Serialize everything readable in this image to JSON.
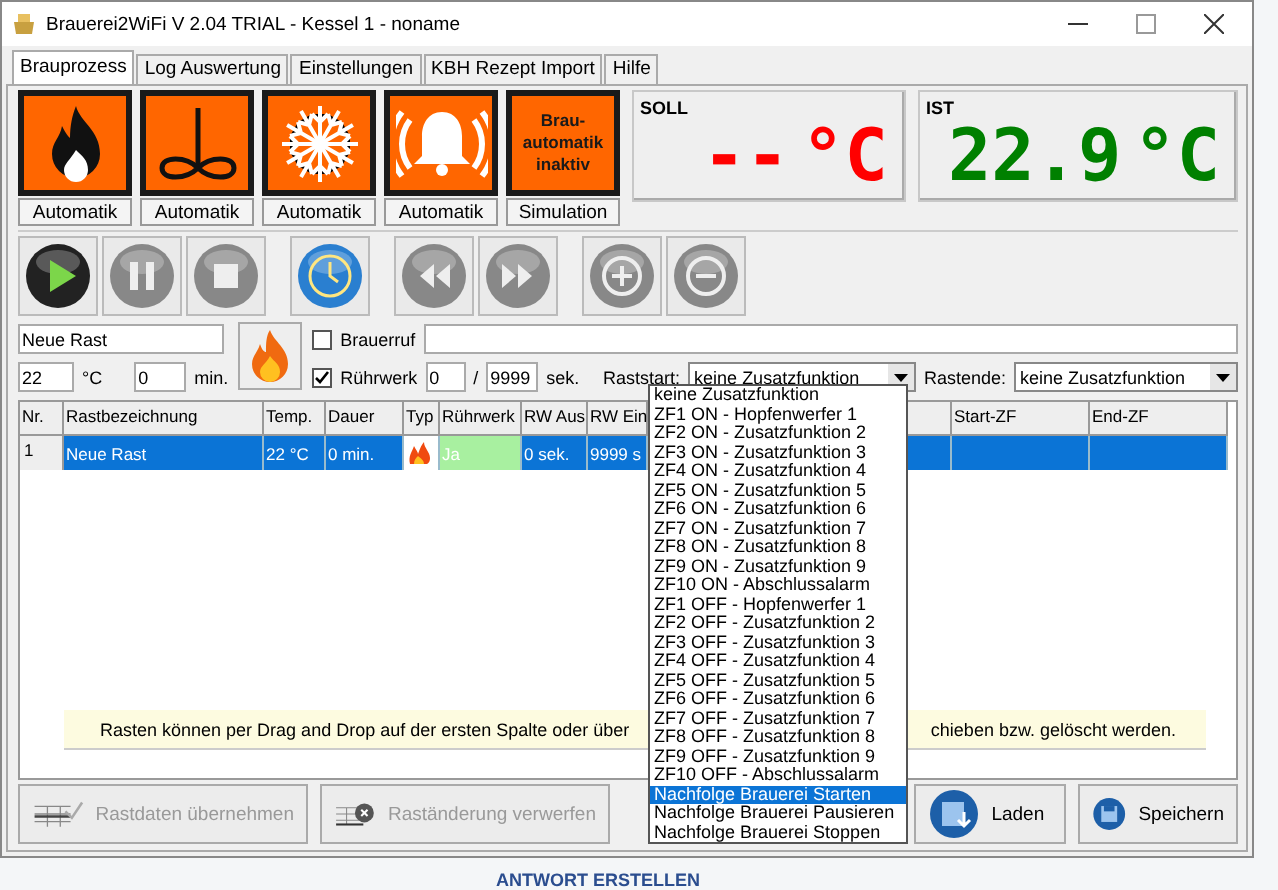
{
  "window": {
    "title": "Brauerei2WiFi V 2.04 TRIAL - Kessel 1 - noname"
  },
  "tabs": [
    {
      "label": "Brauprozess",
      "selected": true
    },
    {
      "label": "Log Auswertung",
      "selected": false
    },
    {
      "label": "Einstellungen",
      "selected": false
    },
    {
      "label": "KBH Rezept Import",
      "selected": false
    },
    {
      "label": "Hilfe",
      "selected": false
    }
  ],
  "actuators": [
    {
      "kind": "flame",
      "label": "Automatik"
    },
    {
      "kind": "stirrer",
      "label": "Automatik"
    },
    {
      "kind": "snowflake",
      "label": "Automatik"
    },
    {
      "kind": "bell",
      "label": "Automatik"
    },
    {
      "kind": "text",
      "lines": [
        "Brau-",
        "automatik",
        "inaktiv"
      ],
      "label": "Simulation"
    }
  ],
  "displays": [
    {
      "label": "SOLL",
      "value": "--",
      "unit": "°C",
      "color": "#ff0000"
    },
    {
      "label": "IST",
      "value": "22.9",
      "unit": "°C",
      "color": "#008000"
    }
  ],
  "toolbar": [
    {
      "kind": "play",
      "disabled": false
    },
    {
      "kind": "pause",
      "disabled": true
    },
    {
      "kind": "stop",
      "disabled": true
    },
    {
      "kind": "clock",
      "disabled": false
    },
    {
      "kind": "rewind",
      "disabled": true
    },
    {
      "kind": "forward",
      "disabled": true
    },
    {
      "kind": "plus",
      "disabled": true
    },
    {
      "kind": "minus",
      "disabled": true
    }
  ],
  "form": {
    "name": "Neue Rast",
    "temp": "22",
    "temp_unit": "°C",
    "duration": "0",
    "duration_unit": "min.",
    "brauerruf": {
      "label": "Brauerruf",
      "checked": false
    },
    "ruehrwerk": {
      "label": "Rührwerk",
      "checked": true
    },
    "rw_off": "0",
    "separator": "/",
    "rw_on": "9999",
    "rw_unit": "sek.",
    "raststart": {
      "label": "Raststart:",
      "value": "keine Zusatzfunktion"
    },
    "rastende": {
      "label": "Rastende:",
      "value": "keine Zusatzfunktion"
    }
  },
  "table": {
    "columns": [
      "Nr.",
      "Rastbezeichnung",
      "Temp.",
      "Dauer",
      "Typ",
      "Rührwerk",
      "RW Aus",
      "RW Ein",
      "Start-ZF",
      "End-ZF"
    ],
    "rows": [
      {
        "nr": "1",
        "name": "Neue Rast",
        "temp": "22 °C",
        "duration": "0 min.",
        "kind": "heat",
        "stirrer": "Ja",
        "stirrer_on": true,
        "rw_off": "0 sek.",
        "rw_on": "9999 s",
        "selected": true
      }
    ]
  },
  "hint": {
    "left": "Rasten können per Drag and Drop auf der ersten Spalte oder über",
    "right": "chieben bzw. gelöscht werden."
  },
  "buttons": [
    {
      "kind": "apply",
      "label": "Rastdaten übernehmen",
      "disabled": true
    },
    {
      "kind": "discard",
      "label": "Raständerung verwerfen",
      "disabled": true
    },
    {
      "kind": "load",
      "label": "Laden",
      "disabled": false
    },
    {
      "kind": "save",
      "label": "Speichern",
      "disabled": false
    }
  ],
  "dropdown": {
    "items": [
      {
        "label": "keine Zusatzfunktion",
        "selected": false
      },
      {
        "label": "ZF1 ON - Hopfenwerfer 1",
        "selected": false
      },
      {
        "label": "ZF2 ON - Zusatzfunktion 2",
        "selected": false
      },
      {
        "label": "ZF3 ON - Zusatzfunktion 3",
        "selected": false
      },
      {
        "label": "ZF4 ON - Zusatzfunktion 4",
        "selected": false
      },
      {
        "label": "ZF5 ON - Zusatzfunktion 5",
        "selected": false
      },
      {
        "label": "ZF6 ON - Zusatzfunktion 6",
        "selected": false
      },
      {
        "label": "ZF7 ON - Zusatzfunktion 7",
        "selected": false
      },
      {
        "label": "ZF8 ON - Zusatzfunktion 8",
        "selected": false
      },
      {
        "label": "ZF9 ON - Zusatzfunktion 9",
        "selected": false
      },
      {
        "label": "ZF10 ON - Abschlussalarm",
        "selected": false
      },
      {
        "label": "ZF1 OFF - Hopfenwerfer 1",
        "selected": false
      },
      {
        "label": "ZF2 OFF - Zusatzfunktion 2",
        "selected": false
      },
      {
        "label": "ZF3 OFF - Zusatzfunktion 3",
        "selected": false
      },
      {
        "label": "ZF4 OFF - Zusatzfunktion 4",
        "selected": false
      },
      {
        "label": "ZF5 OFF - Zusatzfunktion 5",
        "selected": false
      },
      {
        "label": "ZF6 OFF - Zusatzfunktion 6",
        "selected": false
      },
      {
        "label": "ZF7 OFF - Zusatzfunktion 7",
        "selected": false
      },
      {
        "label": "ZF8 OFF - Zusatzfunktion 8",
        "selected": false
      },
      {
        "label": "ZF9 OFF - Zusatzfunktion 9",
        "selected": false
      },
      {
        "label": "ZF10 OFF - Abschlussalarm",
        "selected": false
      },
      {
        "label": "Nachfolge Brauerei Starten",
        "selected": true
      },
      {
        "label": "Nachfolge Brauerei Pausieren",
        "selected": false
      },
      {
        "label": "Nachfolge Brauerei Stoppen",
        "selected": false
      }
    ]
  },
  "background": {
    "text": "ANTWORT ERSTELLEN"
  }
}
